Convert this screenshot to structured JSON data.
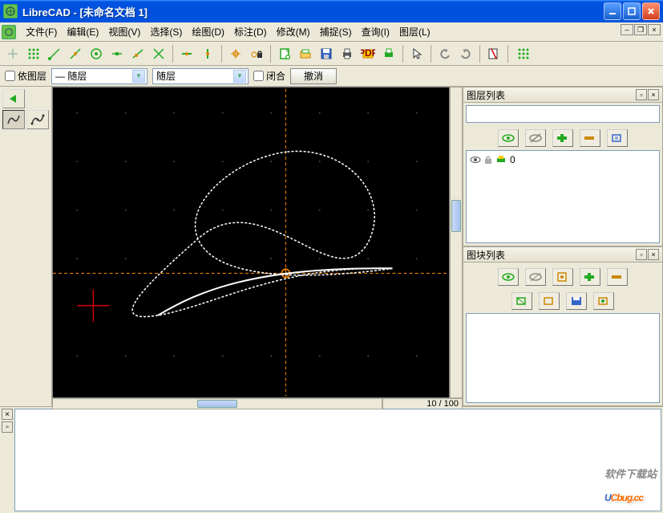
{
  "window": {
    "title": "LibreCAD - [未命名文档 1]"
  },
  "menu": {
    "file": "文件(F)",
    "edit": "编辑(E)",
    "view": "视图(V)",
    "select": "选择(S)",
    "draw": "绘图(D)",
    "dimension": "标注(D)",
    "modify": "修改(M)",
    "snap": "捕捉(S)",
    "info": "查询(I)",
    "layer": "图层(L)"
  },
  "layerbar": {
    "bylayer_checkbox": "依图层",
    "combo1": "— 随层",
    "combo2": "随层",
    "close_checkbox": "闭合",
    "cancel_btn": "撤消"
  },
  "canvas": {
    "coords": "10 / 100"
  },
  "panels": {
    "layers": {
      "title": "图层列表",
      "item0": "0"
    },
    "blocks": {
      "title": "图块列表"
    }
  },
  "watermark": {
    "line1": "软件下载站",
    "brand_u": "U",
    "brand_rest": "Cbug.cc"
  },
  "icons": {
    "eye": "eye",
    "lock": "lock",
    "plus": "plus",
    "minus": "minus",
    "printer": "printer",
    "save": "save",
    "open": "open"
  }
}
